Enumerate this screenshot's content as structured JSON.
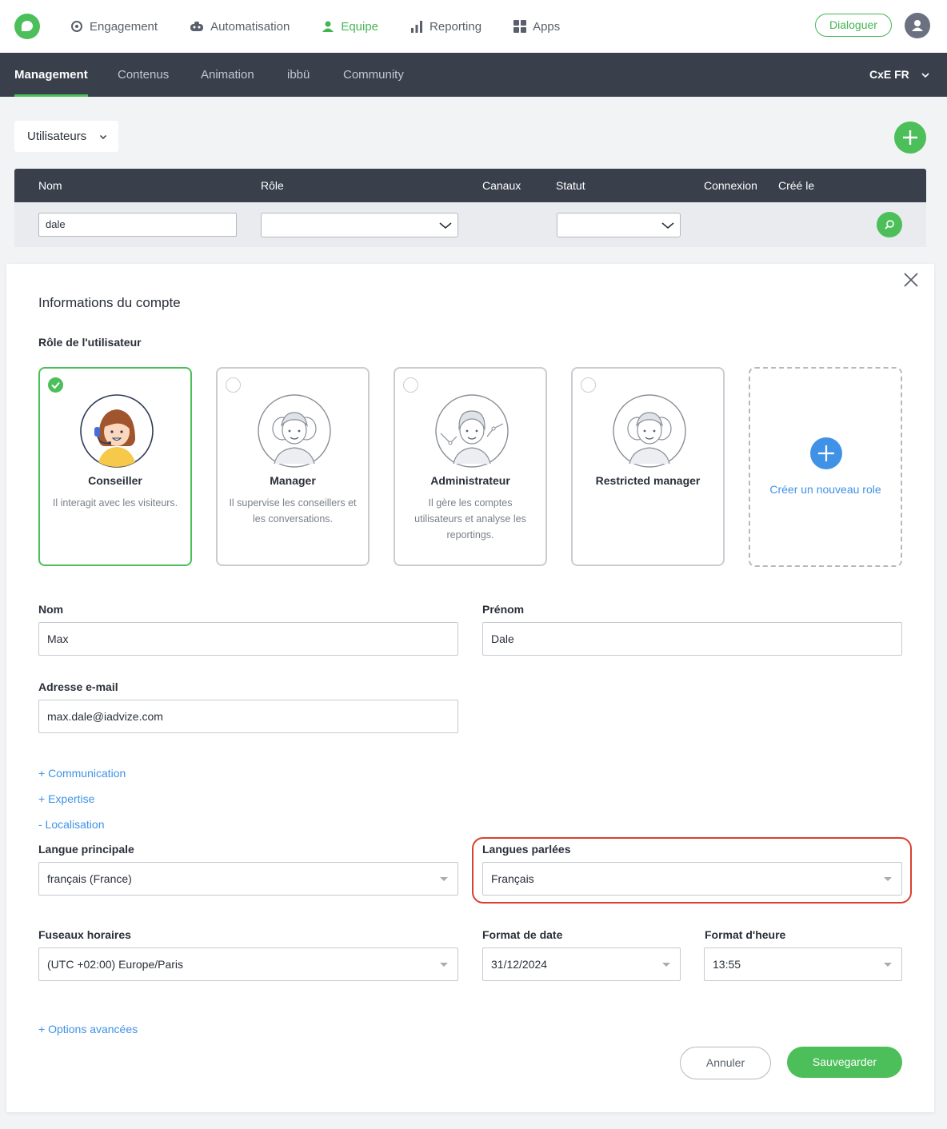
{
  "topnav": {
    "items": [
      {
        "label": "Engagement",
        "icon": "target-icon"
      },
      {
        "label": "Automatisation",
        "icon": "robot-icon"
      },
      {
        "label": "Equipe",
        "icon": "person-icon"
      },
      {
        "label": "Reporting",
        "icon": "bar-chart-icon"
      },
      {
        "label": "Apps",
        "icon": "grid-icon"
      }
    ],
    "active": "Equipe",
    "dialog_button": "Dialoguer"
  },
  "subnav": {
    "tabs": [
      "Management",
      "Contenus",
      "Animation",
      "ibbü",
      "Community"
    ],
    "active": "Management",
    "org": "CxE FR"
  },
  "filters": {
    "view_select": "Utilisateurs",
    "columns": [
      "Nom",
      "Rôle",
      "Canaux",
      "Statut",
      "Connexion",
      "Créé le"
    ],
    "name_value": "dale"
  },
  "panel": {
    "title": "Informations du compte",
    "role_label": "Rôle de l'utilisateur",
    "roles": [
      {
        "name": "Conseiller",
        "desc": "Il interagit avec les visiteurs.",
        "selected": true
      },
      {
        "name": "Manager",
        "desc": "Il supervise les conseillers et les conversations.",
        "selected": false
      },
      {
        "name": "Administrateur",
        "desc": "Il gère les comptes utilisateurs et analyse les reportings.",
        "selected": false
      },
      {
        "name": "Restricted manager",
        "desc": "",
        "selected": false
      }
    ],
    "new_role": "Créer un nouveau role",
    "nom_label": "Nom",
    "nom_value": "Max",
    "prenom_label": "Prénom",
    "prenom_value": "Dale",
    "email_label": "Adresse e-mail",
    "email_value": "max.dale@iadvize.com",
    "links": {
      "communication": "+ Communication",
      "expertise": "+ Expertise",
      "localisation": "- Localisation",
      "advanced": "+ Options avancées"
    },
    "langue_principale_label": "Langue principale",
    "langue_principale_value": "français (France)",
    "langues_parlees_label": "Langues parlées",
    "langues_parlees_value": "Français",
    "fuseau_label": "Fuseaux horaires",
    "fuseau_value": "(UTC +02:00) Europe/Paris",
    "date_label": "Format de date",
    "date_value": "31/12/2024",
    "heure_label": "Format d'heure",
    "heure_value": "13:55",
    "cancel": "Annuler",
    "save": "Sauvegarder"
  },
  "colors": {
    "brand_green": "#4cbf5a",
    "dark_nav": "#3a3f4c",
    "link_blue": "#3f92e6",
    "highlight_red": "#d9402f"
  }
}
